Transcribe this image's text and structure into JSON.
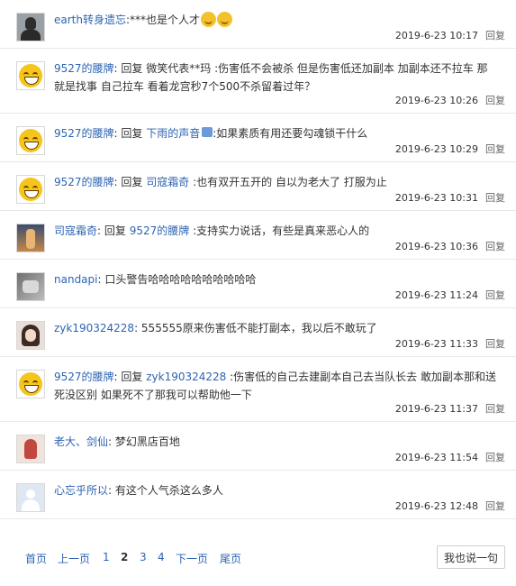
{
  "comments": [
    {
      "user": "earth转身遗忘",
      "prefix": "",
      "reply_to": "",
      "content": "***也是个人才",
      "time": "2019-6-23 10:17",
      "reply": "回复",
      "avatar": "earth-avatar"
    },
    {
      "user": "9527的腰牌",
      "prefix": "回复 微笑代表**玛",
      "reply_to": "",
      "content": ":伤害低不会被杀 但是伤害低还加副本 加副本还不拉车 那就是找事 自己拉车 看着龙宫秒7个500不杀留着过年？",
      "time": "2019-6-23 10:26",
      "reply": "回复",
      "avatar": "smiley-avatar"
    },
    {
      "user": "9527的腰牌",
      "prefix": "回复",
      "reply_to": "下雨的声音",
      "content": ":如果素质有用还要勾魂锁干什么",
      "time": "2019-6-23 10:29",
      "reply": "回复",
      "avatar": "smiley-avatar"
    },
    {
      "user": "9527的腰牌",
      "prefix": "回复",
      "reply_to": "司寇霜奇",
      "content": ":也有双开五开的 自以为老大了 打服为止",
      "time": "2019-6-23 10:31",
      "reply": "回复",
      "avatar": "smiley-avatar"
    },
    {
      "user": "司寇霜奇",
      "prefix": "回复",
      "reply_to": "9527的腰牌",
      "content": ":支持实力说话，有些是真来恶心人的",
      "time": "2019-6-23 10:36",
      "reply": "回复",
      "avatar": "sikou-avatar"
    },
    {
      "user": "nandapi",
      "prefix": "",
      "reply_to": "",
      "content": "口头警告哈哈哈哈哈哈哈哈哈哈",
      "time": "2019-6-23 11:24",
      "reply": "回复",
      "avatar": "nandapi-avatar"
    },
    {
      "user": "zyk190324228",
      "prefix": "",
      "reply_to": "",
      "content": "555555原来伤害低不能打副本，我以后不敢玩了",
      "time": "2019-6-23 11:33",
      "reply": "回复",
      "avatar": "zyk-avatar"
    },
    {
      "user": "9527的腰牌",
      "prefix": "回复",
      "reply_to": "zyk190324228",
      "content": ":伤害低的自己去建副本自己去当队长去 敢加副本那和送死没区别 如果死不了那我可以帮助他一下",
      "time": "2019-6-23 11:37",
      "reply": "回复",
      "avatar": "smiley-avatar"
    },
    {
      "user": "老大、剑仙",
      "prefix": "",
      "reply_to": "",
      "content": "梦幻黑店百地",
      "time": "2019-6-23 11:54",
      "reply": "回复",
      "avatar": "laoda-avatar"
    },
    {
      "user": "心忘乎所以",
      "prefix": "",
      "reply_to": "",
      "content": "有这个人气杀这么多人",
      "time": "2019-6-23 12:48",
      "reply": "回复",
      "avatar": "default-avatar"
    }
  ],
  "pagination": {
    "first": "首页",
    "prev": "上一页",
    "pages": [
      "1",
      "2",
      "3",
      "4"
    ],
    "current": "2",
    "next": "下一页",
    "last": "尾页"
  },
  "say_button": "我也说一句",
  "colors": {
    "link": "#2d64b3",
    "text": "#333333",
    "divider": "#e8e8e8"
  }
}
